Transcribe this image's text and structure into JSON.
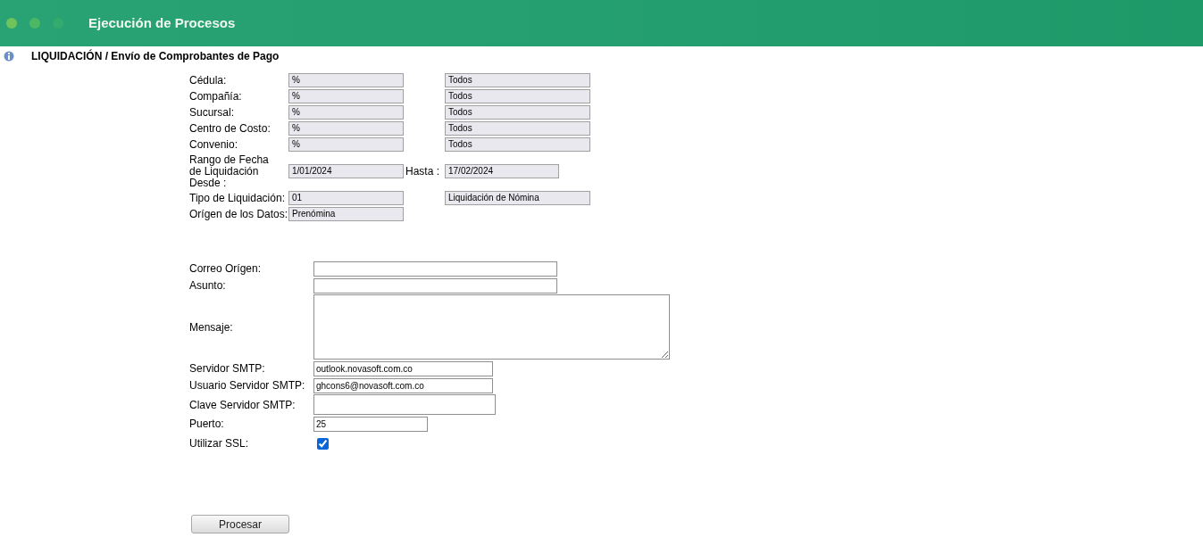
{
  "window": {
    "title": "Ejecución de Procesos"
  },
  "heading": "LIQUIDACIÓN / Envío de Comprobantes de Pago",
  "filters": [
    {
      "label": "Cédula:",
      "code": "%",
      "description": "Todos"
    },
    {
      "label": "Compañía:",
      "code": "%",
      "description": "Todos"
    },
    {
      "label": "Sucursal:",
      "code": "%",
      "description": "Todos"
    },
    {
      "label": "Centro de Costo:",
      "code": "%",
      "description": "Todos"
    },
    {
      "label": "Convenio:",
      "code": "%",
      "description": "Todos"
    }
  ],
  "date_range": {
    "label": "Rango de Fecha de Liquidación Desde :",
    "from": "1/01/2024",
    "to_label": "Hasta :",
    "to": "17/02/2024"
  },
  "settlement_type": {
    "label": "Tipo de Liquidación:",
    "code": "01",
    "description": "Liquidación de Nómina"
  },
  "data_origin": {
    "label": "Orígen de los Datos:",
    "value": "Prenómina"
  },
  "email_fields": [
    {
      "kind": "text",
      "label": "Correo Orígen:"
    },
    {
      "kind": "text",
      "label": "Asunto:"
    },
    {
      "kind": "textarea",
      "label": "Mensaje:"
    },
    {
      "kind": "short",
      "label": "Servidor SMTP:",
      "value": "outlook.novasoft.com.co"
    },
    {
      "kind": "short",
      "label": "Usuario Servidor SMTP:",
      "value": "ghcons6@novasoft.com.co"
    },
    {
      "kind": "password",
      "label": "Clave Servidor SMTP:"
    },
    {
      "kind": "port",
      "label": "Puerto:",
      "value": "25"
    },
    {
      "kind": "checkbox",
      "label": "Utilizar SSL:",
      "checked": true
    }
  ],
  "button": "Procesar"
}
